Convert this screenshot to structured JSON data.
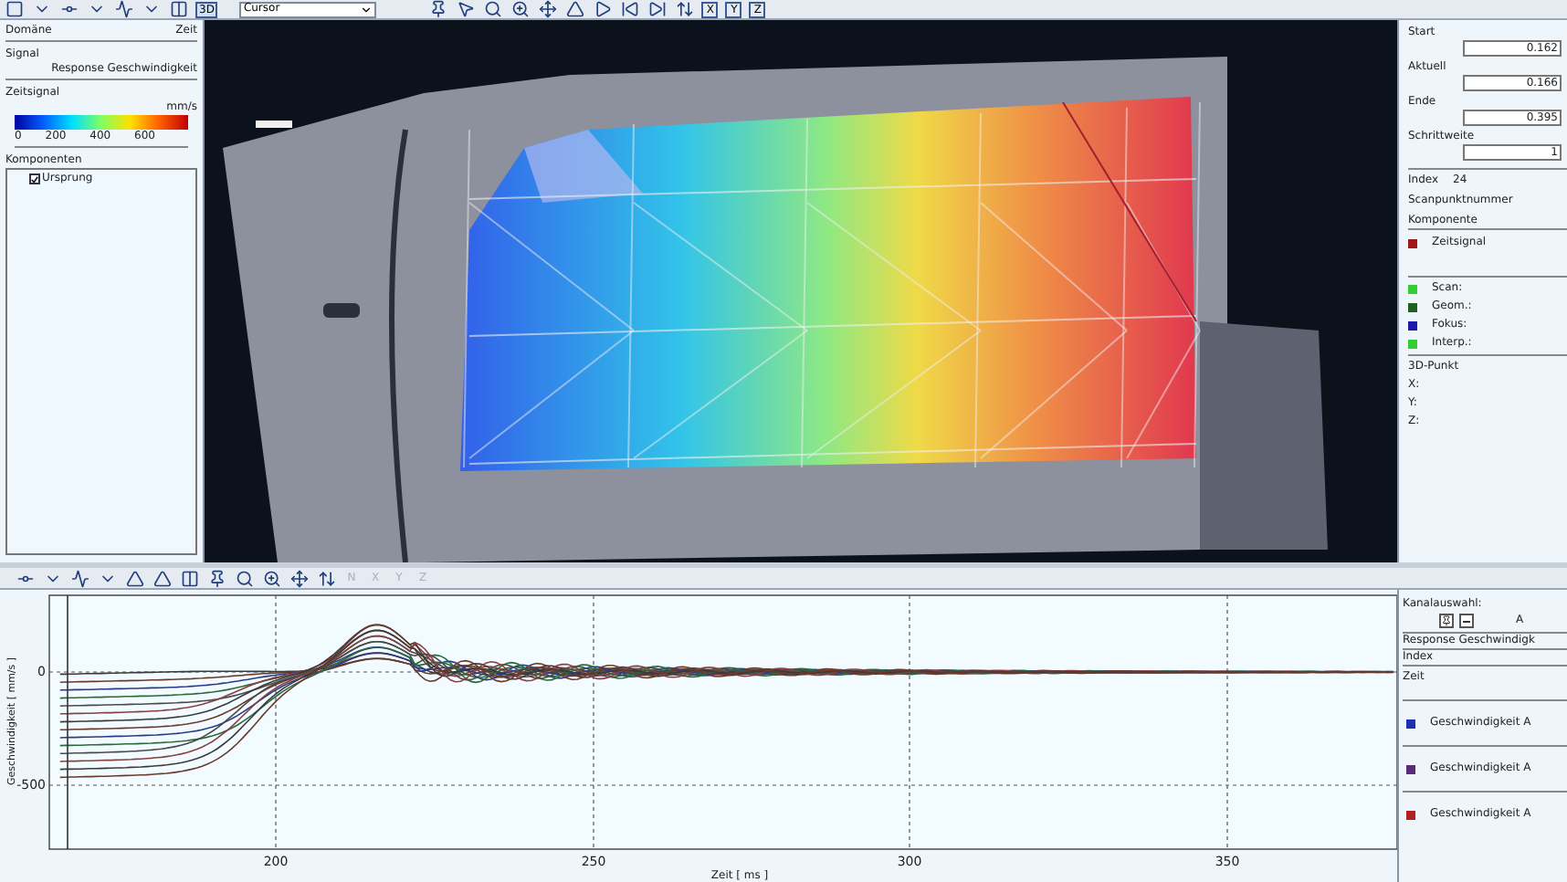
{
  "toolbar": {
    "mode_dropdown": {
      "value": "Cursor"
    },
    "view_button": {
      "label": "3D",
      "selected": true
    },
    "axis_buttons": [
      {
        "label": "X",
        "selected": false
      },
      {
        "label": "Y",
        "selected": false
      },
      {
        "label": "Z",
        "selected": false
      }
    ]
  },
  "left_panel": {
    "domain": {
      "label": "Domäne",
      "value": "Zeit"
    },
    "signal": {
      "label": "Signal",
      "value": "Response Geschwindigkeit"
    },
    "legend": {
      "title": "Zeitsignal",
      "unit": "mm/s",
      "ticks": [
        "0",
        "200",
        "400",
        "600"
      ]
    },
    "components": {
      "title": "Komponenten",
      "items": [
        {
          "label": "Ursprung",
          "checked": true
        }
      ]
    }
  },
  "right_panel": {
    "fields": [
      {
        "label": "Start",
        "value": "0.162"
      },
      {
        "label": "Aktuell",
        "value": "0.166"
      },
      {
        "label": "Ende",
        "value": "0.395"
      },
      {
        "label": "Schrittweite",
        "value": "1"
      }
    ],
    "index": {
      "label": "Index",
      "value": "24"
    },
    "scan_point_label": "Scanpunktnummer",
    "component_label": "Komponente",
    "component": {
      "label": "Zeitsignal",
      "color": "#a01818"
    },
    "status": [
      {
        "label": "Scan:",
        "color": "#33cc33"
      },
      {
        "label": "Geom.:",
        "color": "#1f5f1f"
      },
      {
        "label": "Fokus:",
        "color": "#1a1aa8"
      },
      {
        "label": "Interp.:",
        "color": "#33cc33"
      }
    ],
    "point": {
      "title": "3D-Punkt",
      "axes": [
        "X:",
        "Y:",
        "Z:"
      ]
    }
  },
  "bottom_toolbar": {
    "axis_buttons": [
      {
        "label": "N",
        "disabled": true
      },
      {
        "label": "X",
        "disabled": true
      },
      {
        "label": "Y",
        "disabled": true
      },
      {
        "label": "Z",
        "disabled": true
      }
    ]
  },
  "chart": {
    "ylabel": "Geschwindigkeit [ mm/s ]",
    "xlabel": "Zeit [ ms ]",
    "yticks": [
      "0",
      "-500"
    ],
    "xticks": [
      "200",
      "250",
      "300",
      "350"
    ]
  },
  "channel_panel": {
    "title": "Kanalauswahl:",
    "button_label": "A",
    "signal": "Response Geschwindigk",
    "index_label": "Index",
    "time_label": "Zeit",
    "channels": [
      {
        "label": "Geschwindigkeit A",
        "color": "#1f2fb0"
      },
      {
        "label": "Geschwindigkeit A",
        "color": "#5a2a7a"
      },
      {
        "label": "Geschwindigkeit A",
        "color": "#b02020"
      }
    ]
  }
}
